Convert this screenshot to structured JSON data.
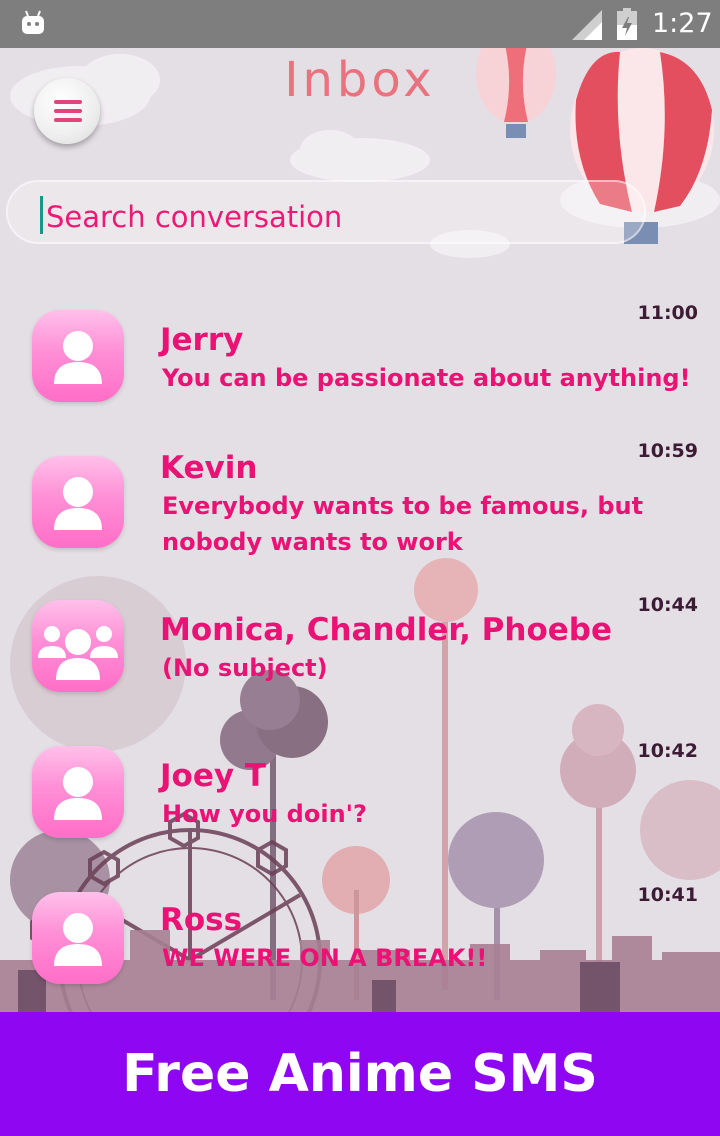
{
  "status_bar": {
    "time": "1:27"
  },
  "header": {
    "title": "Inbox"
  },
  "search": {
    "placeholder": "Search conversation"
  },
  "conversations": [
    {
      "name": "Jerry",
      "time": "11:00",
      "message": " You can be passionate about anything!",
      "avatar": "person-icon"
    },
    {
      "name": "Kevin",
      "time": "10:59",
      "message": " Everybody wants to be famous, but nobody wants to work",
      "avatar": "person-icon"
    },
    {
      "name": "Monica, Chandler, Phoebe",
      "time": "10:44",
      "message": "(No subject)",
      "avatar": "group-icon"
    },
    {
      "name": "Joey T",
      "time": "10:42",
      "message": "How you doin'?",
      "avatar": "person-icon"
    },
    {
      "name": "Ross",
      "time": "10:41",
      "message": "WE WERE ON A BREAK!!",
      "avatar": "person-icon"
    }
  ],
  "promo": {
    "text": "Free Anime SMS"
  },
  "colors": {
    "accent": "#ea1275",
    "promo_bg": "#8f06f2",
    "status_bar": "#7e7e7e",
    "title": "#e9727f"
  }
}
